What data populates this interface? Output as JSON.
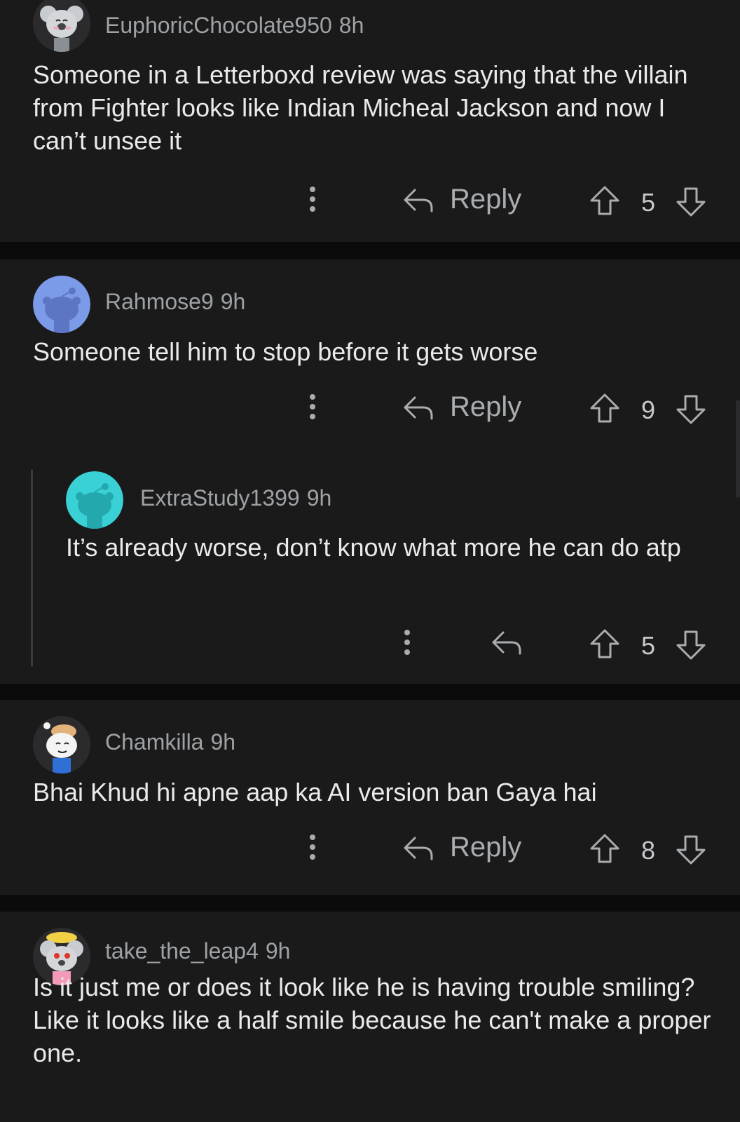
{
  "comments": [
    {
      "username": "EuphoricChocolate950",
      "time": "8h",
      "avatar": "koala-snoo",
      "text": "Someone in a Letterboxd review was saying that the villain from Fighter looks like Indian Micheal Jackson and now I can’t unsee it",
      "reply_label": "Reply",
      "votes": "5"
    },
    {
      "username": "Rahmose9",
      "time": "9h",
      "avatar": "default-snoo-blue",
      "text": "Someone tell him to stop before it gets worse",
      "reply_label": "Reply",
      "votes": "9"
    },
    {
      "username": "ExtraStudy1399",
      "time": "9h",
      "avatar": "default-snoo-teal",
      "text": "It’s already worse, don’t know what more he can do atp",
      "reply_label": "",
      "votes": "5"
    },
    {
      "username": "Chamkilla",
      "time": "9h",
      "avatar": "snoo-blonde",
      "text": "Bhai Khud hi apne aap ka AI version ban Gaya hai",
      "reply_label": "Reply",
      "votes": "8"
    },
    {
      "username": "take_the_leap4",
      "time": "9h",
      "avatar": "koala-snoo-pink",
      "text": "Is it just me or does it look like he is having trouble smiling? Like it looks like a half smile because he can't make a proper one.",
      "reply_label": "",
      "votes": ""
    }
  ],
  "colors": {
    "background": "#0b0b0c",
    "card": "#1a1a1b",
    "blue_avatar": "#7b9ae8",
    "teal_avatar": "#3ad1d6"
  }
}
